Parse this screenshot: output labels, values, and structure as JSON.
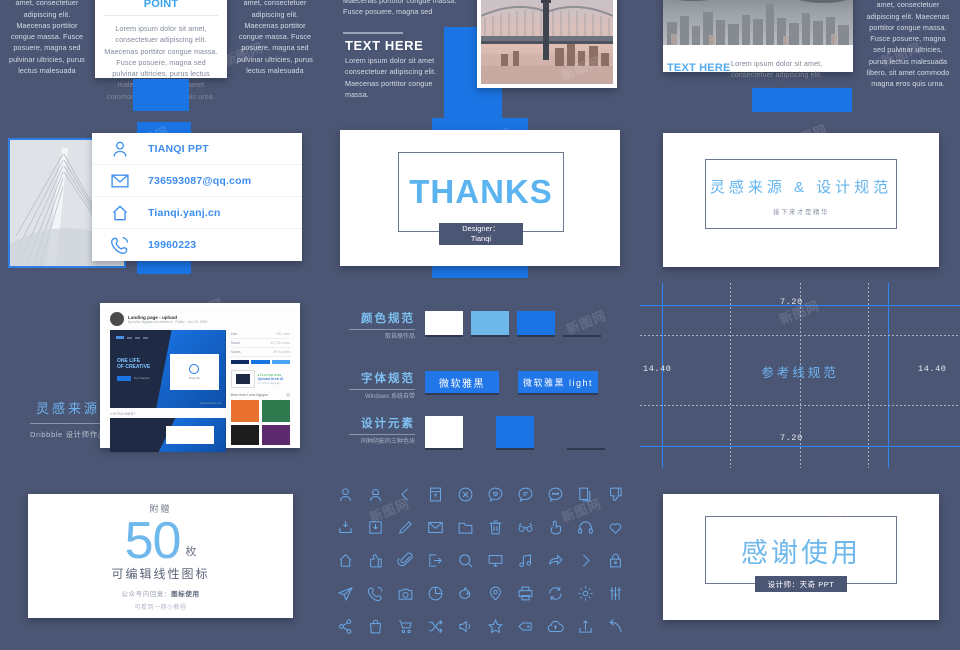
{
  "theme": {
    "background": "#4b5674",
    "accent_blue": "#1b74e4",
    "light_blue": "#6fb8ec",
    "white": "#ffffff"
  },
  "lorem": {
    "short": "Lorem ipsum dolor sit amet, consectetuer adipiscing elit. Maecenas porttitor congue massa. Fusce posuere, magna sed pulvinar ultricies, purus lectus malesuada",
    "long": "Lorem ipsum dolor sit amet, consectetuer adipiscing elit. Maecenas porttitor congue massa. Fusce posuere, magna sed pulvinar ultricies, purus lectus malesuada libero, sit amet commodo magna eros quis urna.",
    "medium": "Lorem ipsum dolor sit amet, consectetuer adipiscing elit. Maecenas porttitor congue massa. Fusce posuere, magna sed",
    "tiny": "Lorem ipsum dolor sit amet consectetuer adipiscing elit. Maecenas porttitor congue massa."
  },
  "slide_power": {
    "title": "POWER YOUR POINT"
  },
  "slide_bridge": {
    "heading": "TEXT HERE"
  },
  "slide_city": {
    "heading": "TEXT HERE"
  },
  "contact": {
    "rows": [
      {
        "icon": "user-icon",
        "value": "TIANQI PPT"
      },
      {
        "icon": "mail-icon",
        "value": "736593087@qq.com"
      },
      {
        "icon": "home-icon",
        "value": "Tianqi.yanj.cn"
      },
      {
        "icon": "phone-icon",
        "value": "19960223"
      }
    ]
  },
  "thanks": {
    "word": "THANKS",
    "designer_label": "Designer：",
    "designer_name": "Tianqi"
  },
  "inspiration_cover": {
    "title": "灵感来源 & 设计规范",
    "subtitle": "接下来才是精华"
  },
  "inspiration": {
    "title": "灵感来源",
    "subtitle": "Dribbble 设计师作品",
    "shot_title": "Landing page - upload",
    "shot_meta": "by Lotus Nguyen for Amber.io · Public · Jun 20, 2019",
    "stats": [
      {
        "label": "Like",
        "value": "531 view"
      },
      {
        "label": "Share",
        "value": "40,755 views"
      },
      {
        "label": "Saves",
        "value": "89 buckets"
      }
    ],
    "attach_label": "1 ATTACHMENT",
    "more_label": "More from Lotus Nguyen"
  },
  "specs": {
    "color": {
      "title": "颜色规范",
      "subtitle": "取自原作品",
      "swatches": [
        "#ffffff",
        "#6fb8ec",
        "#1b74e4",
        "#3d465e"
      ]
    },
    "font": {
      "title": "字体规范",
      "subtitle": "Windows 系统自带",
      "buttons": [
        "微软雅黑",
        "微软雅黑 light"
      ]
    },
    "element": {
      "title": "设计元素",
      "subtitle": "同种阴影的三种色块",
      "blocks": [
        "#ffffff",
        "#1b74e4",
        "#3d465e"
      ]
    }
  },
  "guides": {
    "title": "参考线规范",
    "top": "7.20",
    "bottom": "7.20",
    "left": "14.40",
    "right": "14.40"
  },
  "bonus": {
    "top": "附赠",
    "number": "50",
    "unit": "枚",
    "line2": "可编辑线性图标",
    "line3_prefix": "公众号内回复：",
    "line3_bold": "图标使用",
    "line4": "可看到一期小教程"
  },
  "icons": [
    "user-icon",
    "user-female-icon",
    "back-arrow-icon",
    "book-icon",
    "close-circle-icon",
    "heart-chat-icon",
    "chat-lines-icon",
    "chat-dots-icon",
    "copy-icon",
    "thumb-down-icon",
    "inbox-download-icon",
    "download-box-icon",
    "pencil-icon",
    "mail-icon",
    "folder-icon",
    "trash-icon",
    "glasses-icon",
    "click-hand-icon",
    "headphones-icon",
    "heart-icon",
    "home-icon",
    "thumb-up-icon",
    "paperclip-icon",
    "logout-icon",
    "search-icon",
    "monitor-icon",
    "music-note-icon",
    "forward-icon",
    "chevron-right-icon",
    "lock-icon",
    "send-icon",
    "phone-call-icon",
    "camera-icon",
    "pie-chart-icon",
    "piggy-bank-icon",
    "location-pin-icon",
    "printer-icon",
    "refresh-icon",
    "gear-icon",
    "sliders-icon",
    "share-icon",
    "bag-icon",
    "cart-icon",
    "shuffle-icon",
    "volume-icon",
    "star-icon",
    "tag-icon",
    "cloud-upload-icon",
    "upload-icon",
    "undo-arrow-icon"
  ],
  "thank_you": {
    "word": "感谢使用",
    "designer": "设计师：天奇 PPT"
  },
  "watermark": "新图网"
}
